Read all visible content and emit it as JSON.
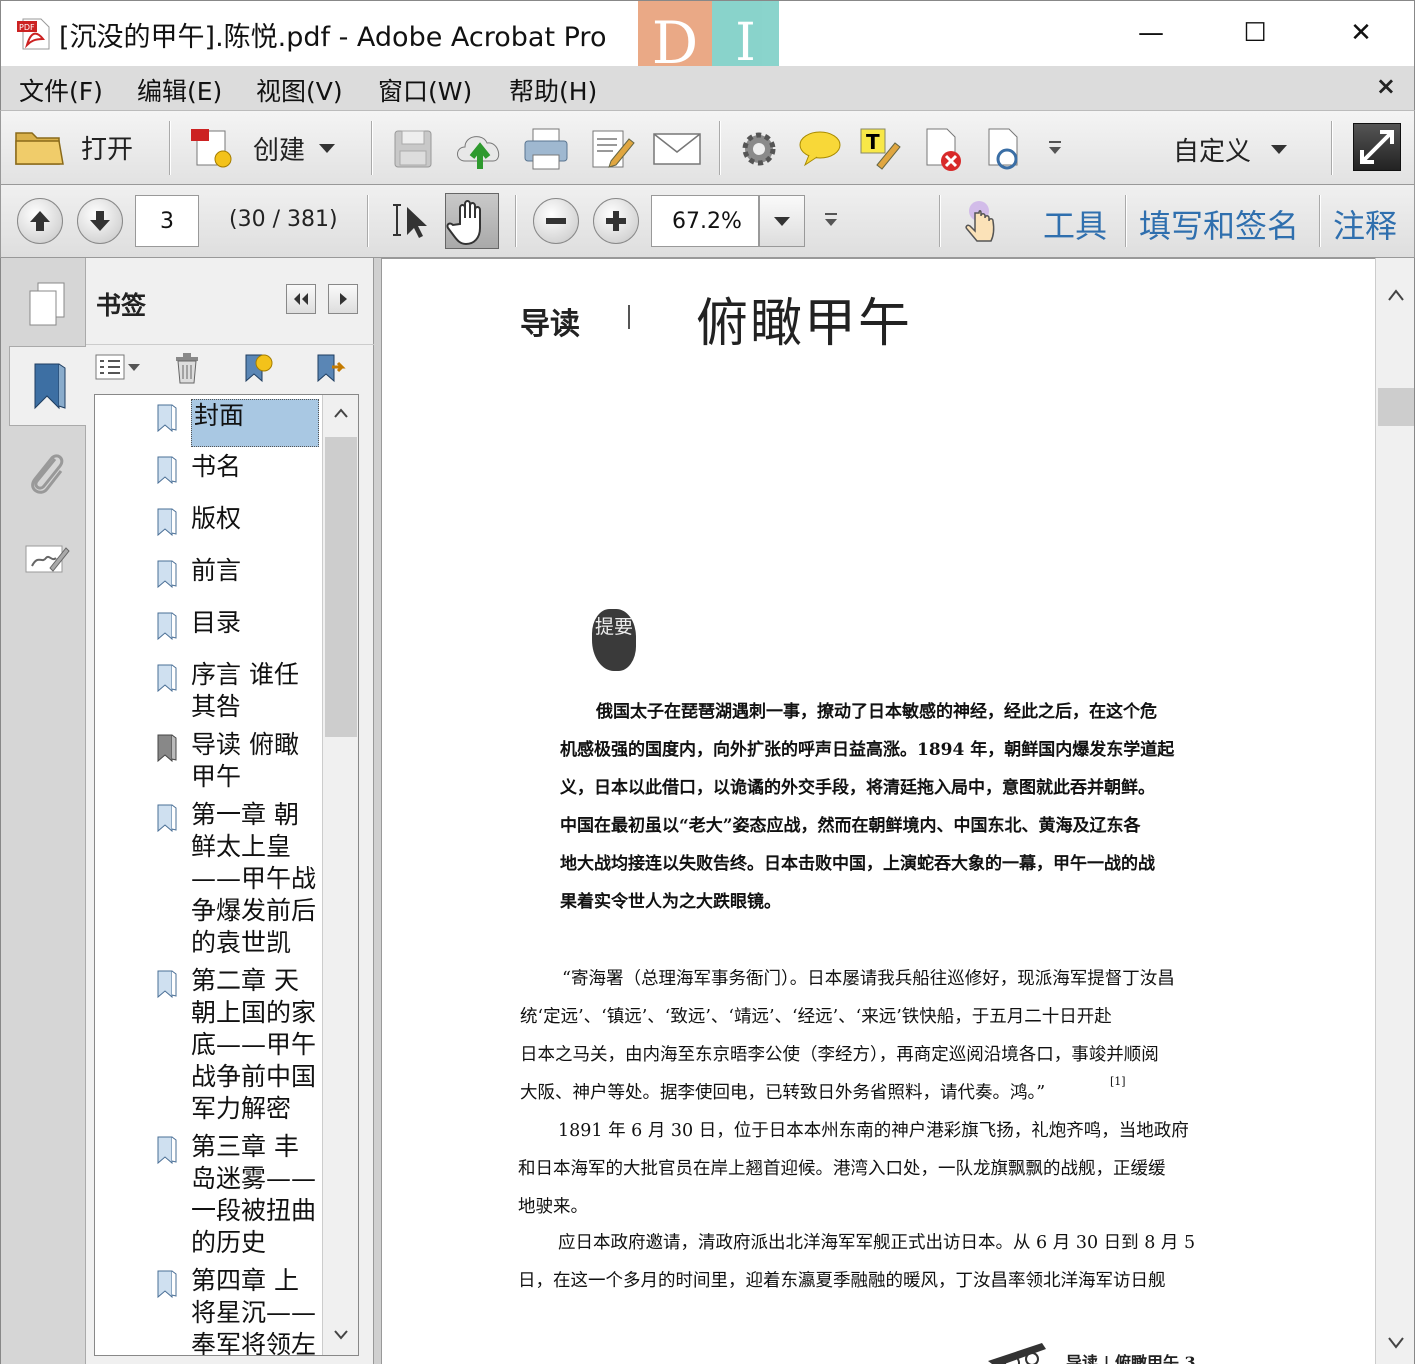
{
  "window": {
    "title": "[沉没的甲午].陈悦.pdf - Adobe Acrobat Pro",
    "logo_letters": [
      "D",
      "I"
    ],
    "controls": {
      "minimize": "—",
      "maximize": "☐",
      "close": "✕"
    }
  },
  "menubar": {
    "items": [
      "文件(F)",
      "编辑(E)",
      "视图(V)",
      "窗口(W)",
      "帮助(H)"
    ],
    "close_doc": "×"
  },
  "toolbar1": {
    "open_label": "打开",
    "create_label": "创建",
    "customize_label": "自定义",
    "icons": [
      "folder-icon",
      "create-pdf-icon",
      "save-icon",
      "cloud-upload-icon",
      "print-icon",
      "edit-icon",
      "email-icon",
      "gear-icon",
      "comment-icon",
      "highlight-text-icon",
      "delete-page-icon",
      "extract-page-icon",
      "more-icon",
      "expand-icon"
    ]
  },
  "toolbar2": {
    "page_number": "3",
    "page_info": "(30 / 381)",
    "zoom": "67.2%",
    "links": {
      "tools": "工具",
      "fill_sign": "填写和签名",
      "comment": "注释"
    }
  },
  "bookmarks_panel": {
    "title": "书签",
    "items": [
      {
        "label": "封面",
        "selected": true
      },
      {
        "label": "书名"
      },
      {
        "label": "版权"
      },
      {
        "label": "前言"
      },
      {
        "label": "目录"
      },
      {
        "label": "序言  谁任其咎"
      },
      {
        "label": "导读  俯瞰甲午",
        "current": true
      },
      {
        "label": "第一章  朝鲜太上皇——甲午战争爆发前后的袁世凯"
      },
      {
        "label": "第二章  天朝上国的家底——甲午战争前中国军力解密"
      },
      {
        "label": "第三章  丰岛迷雾——一段被扭曲的历史"
      },
      {
        "label": "第四章  上将星沉——奉军将领左"
      }
    ]
  },
  "document": {
    "chapter_label": "导读",
    "chapter_title": "俯瞰甲午",
    "stamp_text": "提要",
    "abstract_lines": [
      "俄国太子在琵琶湖遇刺一事，撩动了日本敏感的神经，经此之后，在这个危",
      "机感极强的国度内，向外扩张的呼声日益高涨。1894 年，朝鲜国内爆发东学道起",
      "义，日本以此借口，以诡谲的外交手段，将清廷拖入局中，意图就此吞并朝鲜。",
      "中国在最初虽以“老大”姿态应战，然而在朝鲜境内、中国东北、黄海及辽东各",
      "地大战均接连以失败告终。日本击败中国，上演蛇吞大象的一幕，甲午一战的战",
      "果着实令世人为之大跌眼镜。"
    ],
    "quote_lines": [
      "“寄海署（总理海军事务衙门）。日本屡请我兵船往巡修好，现派海军提督丁汝昌",
      "统‘定远’、‘镇远’、‘致远’、‘靖远’、‘经远’、‘来远’铁快船，于五月二十日开赴",
      "日本之马关，由内海至东京晤李公使（李经方），再商定巡阅沿境各口，事竣并顺阅",
      "大阪、神户等处。据李使回电，已转致日外务省照料，请代奏。鸿。”"
    ],
    "footnote_mark": "[1]",
    "body_lines": [
      "1891 年 6 月 30 日，位于日本本州东南的神户港彩旗飞扬，礼炮齐鸣，当地政府",
      "和日本海军的大批官员在岸上翘首迎候。港湾入口处，一队龙旗飘飘的战舰，正缓缓",
      "地驶来。",
      "应日本政府邀请，清政府派出北洋海军军舰正式出访日本。从 6 月 30 日到 8 月 5",
      "日，在这一个多月的时间里，迎着东瀛夏季融融的暖风，丁汝昌率领北洋海军访日舰"
    ],
    "footer_text": "导读  |  俯瞰甲午     3"
  },
  "colors": {
    "menubar_bg": "#dcdcdc",
    "link_blue": "#2f6fae",
    "selection": "#a9c8e3",
    "acrobat_red": "#cc2222"
  }
}
